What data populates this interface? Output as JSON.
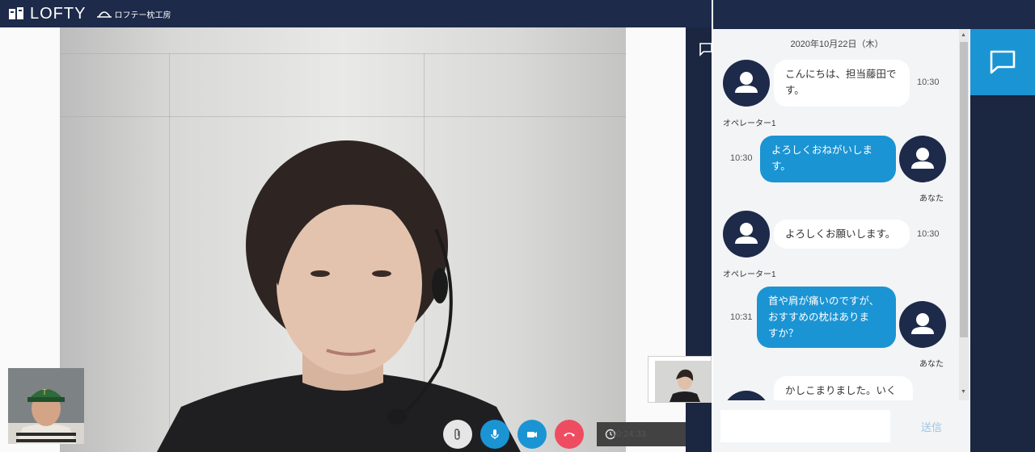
{
  "header": {
    "brand": "LOFTY",
    "sub_brand": "ロフテー枕工房"
  },
  "call": {
    "timer": "00:24:33"
  },
  "chat": {
    "date": "2020年10月22日（木）",
    "messages": [
      {
        "from": "operator",
        "lines": [
          "こんにちは、担当藤田で",
          "す。"
        ],
        "time": "10:30",
        "sender": "オペレーター1"
      },
      {
        "from": "you",
        "lines": [
          "よろしくおねがいしま",
          "す。"
        ],
        "time": "10:30",
        "sender": "あなた"
      },
      {
        "from": "operator",
        "lines": [
          "よろしくお願いします。"
        ],
        "time": "10:30",
        "sender": "オペレーター1"
      },
      {
        "from": "you",
        "lines": [
          "首や肩が痛いのですが、",
          "おすすめの枕はありま",
          "すか？"
        ],
        "time": "10:31",
        "sender": "あなた"
      },
      {
        "from": "operator",
        "lines": [
          "かしこまりました。いく"
        ]
      }
    ],
    "input_placeholder": "",
    "send_label": "送信"
  },
  "colors": {
    "navy": "#1d2a4a",
    "accent_blue": "#1b94d4",
    "hangup_red": "#ee4d61"
  },
  "icons": [
    "logo-icon",
    "headset-icon",
    "attach-icon",
    "mic-icon",
    "camera-icon",
    "hangup-icon",
    "clock-icon",
    "chat-icon",
    "person-icon"
  ]
}
